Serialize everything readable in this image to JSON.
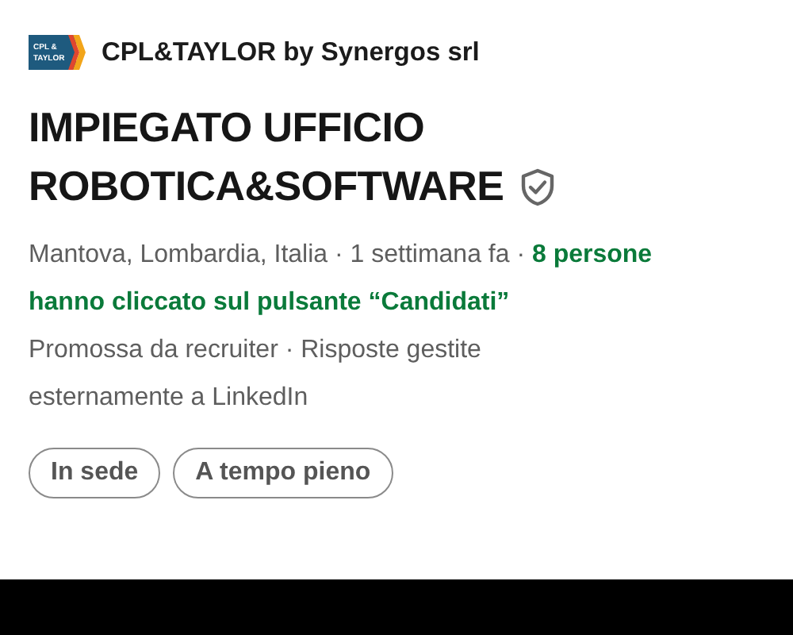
{
  "company": {
    "logo_lines": [
      "CPL &",
      "TAYLOR"
    ],
    "name": "CPL&TAYLOR by Synergos srl"
  },
  "job": {
    "title_lines": [
      "IMPIEGATO UFFICIO",
      "ROBOTICA&SOFTWARE"
    ],
    "verified": true
  },
  "meta": {
    "location": "Mantova, Lombardia, Italia · 1 settimana fa · ",
    "applicants": "8 persone hanno cliccato sul pulsante “Candidati”"
  },
  "note": "Promossa da recruiter · Risposte gestite esternamente a LinkedIn",
  "chips": [
    "In sede",
    "A tempo pieno"
  ]
}
